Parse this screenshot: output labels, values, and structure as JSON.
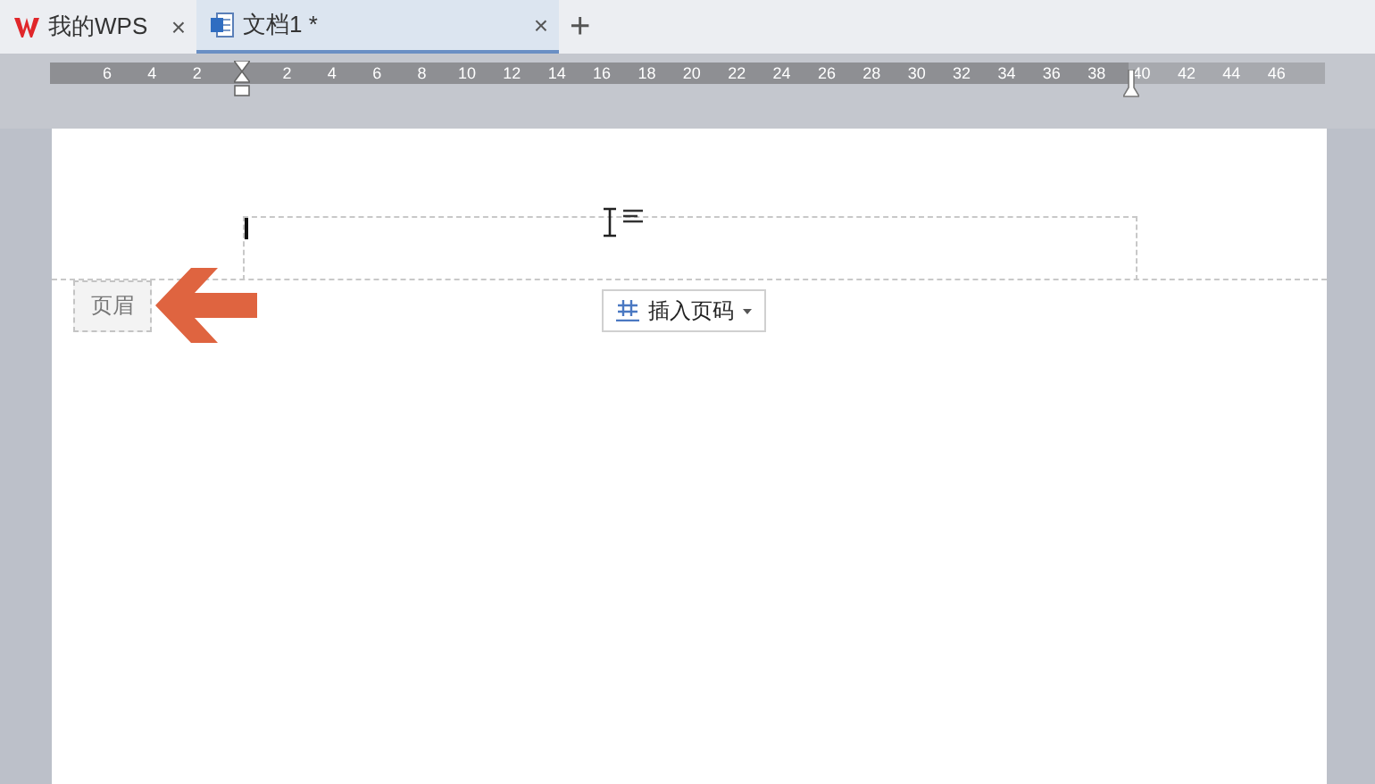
{
  "tabs": [
    {
      "label": "我的WPS",
      "kind": "home",
      "selected": false,
      "close": "×"
    },
    {
      "label": "文档1 *",
      "kind": "document",
      "selected": true,
      "close": "×"
    }
  ],
  "new_tab": "+",
  "ruler": {
    "left_labels": [
      "6",
      "4",
      "2"
    ],
    "right_labels": [
      "2",
      "4",
      "6",
      "8",
      "10",
      "12",
      "14",
      "16",
      "18",
      "20",
      "22",
      "24",
      "26",
      "28",
      "30",
      "32",
      "34",
      "36",
      "38",
      "40",
      "42",
      "44",
      "46"
    ]
  },
  "header": {
    "label": "页眉",
    "insert_page_number_button": "插入页码"
  }
}
